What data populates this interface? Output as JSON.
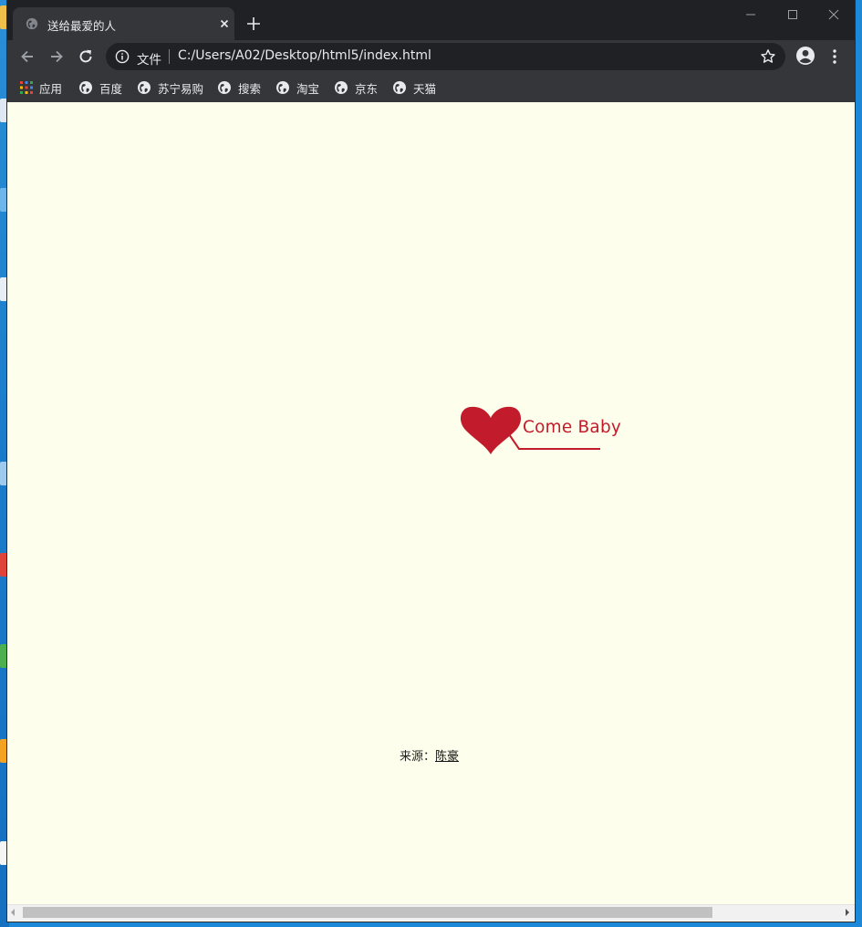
{
  "browser": {
    "tab": {
      "title": "送给最爱的人",
      "favicon": "globe-icon"
    },
    "toolbar": {
      "scheme_label": "文件",
      "url": "C:/Users/A02/Desktop/html5/index.html"
    },
    "bookmarks": [
      {
        "label": "应用",
        "icon": "apps-grid-icon"
      },
      {
        "label": "百度",
        "icon": "globe-icon"
      },
      {
        "label": "苏宁易购",
        "icon": "globe-icon"
      },
      {
        "label": "搜索",
        "icon": "globe-icon"
      },
      {
        "label": "淘宝",
        "icon": "globe-icon"
      },
      {
        "label": "京东",
        "icon": "globe-icon"
      },
      {
        "label": "天猫",
        "icon": "globe-icon"
      }
    ]
  },
  "page": {
    "heart_text": "Come Baby",
    "source_prefix": "来源：",
    "source_link": "陈豪"
  },
  "colors": {
    "page_background": "#fefeec",
    "heart": "#c21b2b",
    "chrome_dark": "#202124",
    "chrome_toolbar": "#35363a"
  }
}
